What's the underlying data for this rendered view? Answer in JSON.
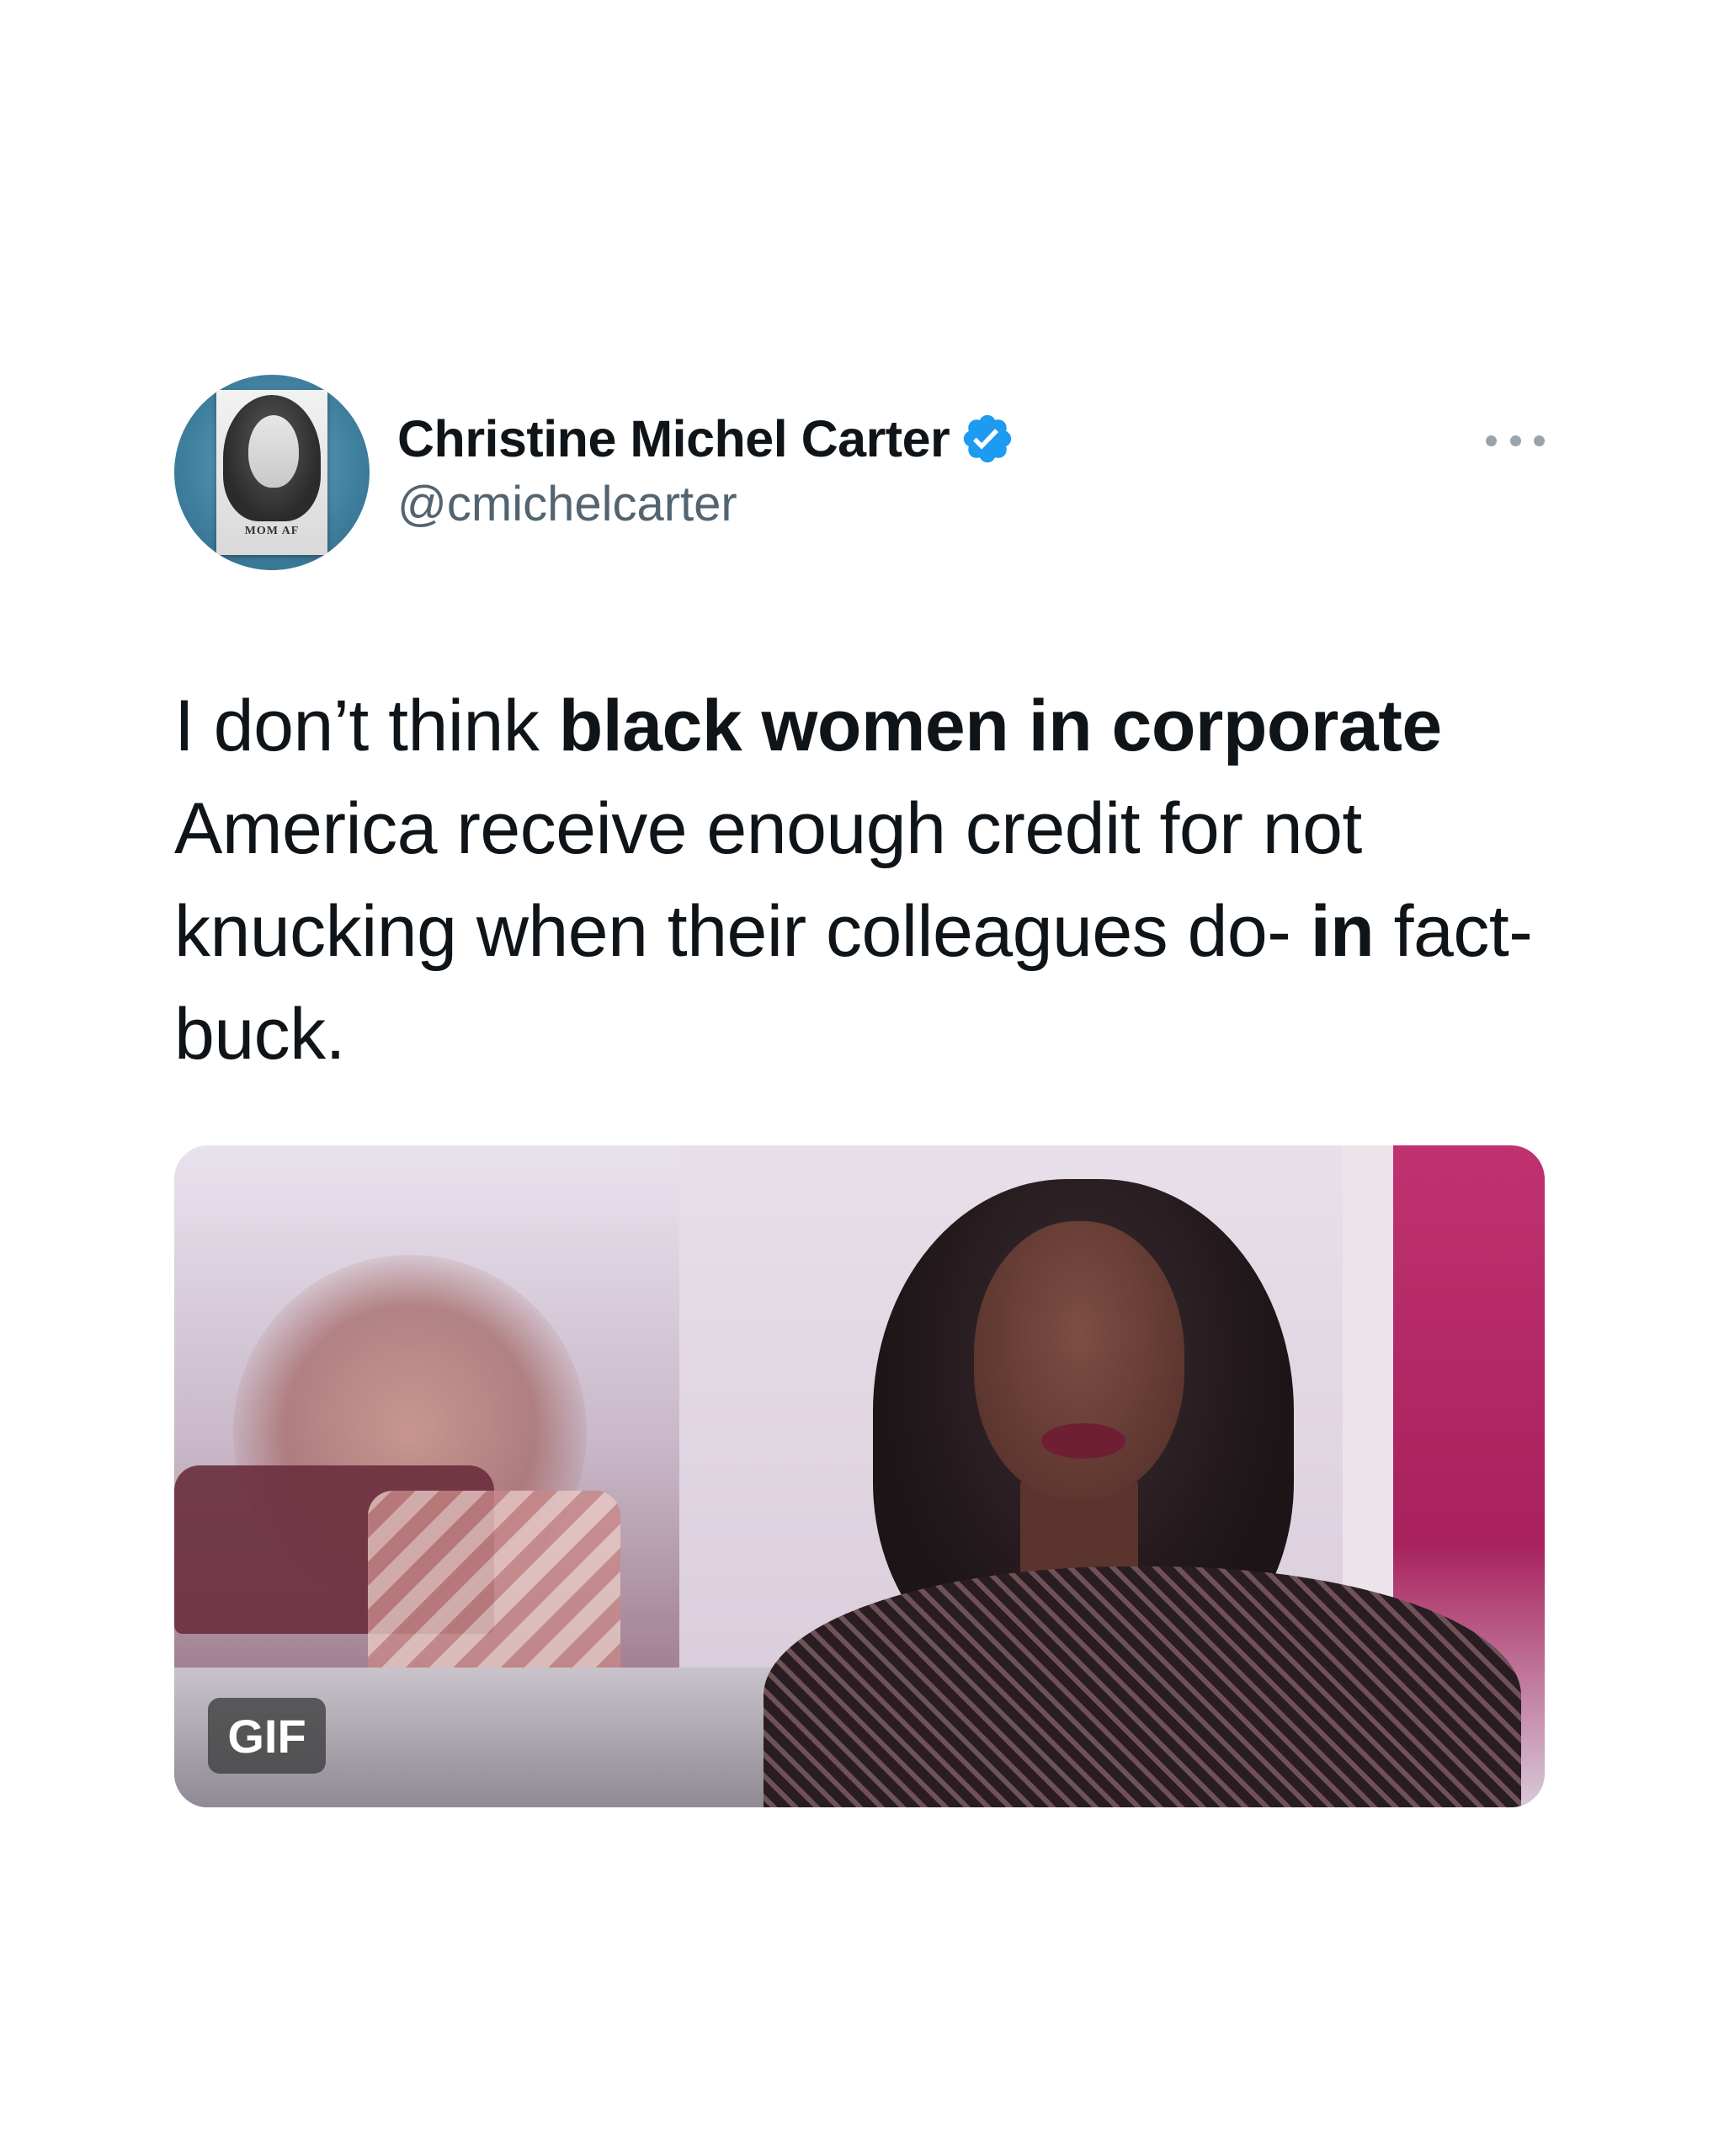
{
  "tweet": {
    "author_name": "Christine Michel Carter",
    "author_handle": "@cmichelcarter",
    "verified": true,
    "avatar_book_title": "MOM AF",
    "text_segments": [
      {
        "text": "I don’t think ",
        "bold": false
      },
      {
        "text": "black women in corporate",
        "bold": true
      },
      {
        "text": " America receive enough credit for not knucking when their colleagues do- ",
        "bold": false
      },
      {
        "text": "in",
        "bold": true
      },
      {
        "text": " fact- buck.",
        "bold": false
      }
    ],
    "media": {
      "type": "gif",
      "badge_label": "GIF"
    }
  },
  "icons": {
    "verified": "verified-badge-icon",
    "more": "more-options-icon"
  },
  "colors": {
    "text": "#0f1419",
    "secondary_text": "#536471",
    "verified_blue": "#1d9bf0",
    "background": "#ffffff"
  }
}
